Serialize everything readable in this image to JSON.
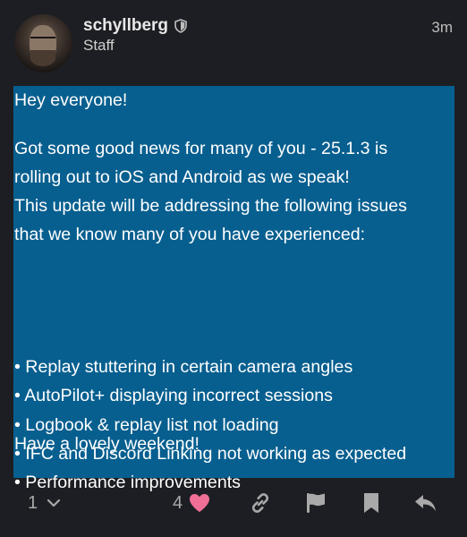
{
  "post": {
    "username": "schyllberg",
    "user_title": "Staff",
    "time_ago": "3m",
    "greeting": "Hey everyone!",
    "paragraph_lines": [
      "Got some good news for many of you - 25.1.3 is",
      "rolling out to iOS and Android as we speak!",
      "This update will be addressing the following issues",
      "that we know many of you have experienced:"
    ],
    "list_items": [
      "• Replay stuttering in certain camera angles",
      "• AutoPilot+ displaying incorrect sessions",
      "• Logbook & replay list not loading",
      "• IFC and Discord Linking not working as expected",
      "• Performance improvements"
    ],
    "closing": "Have a lovely weekend!"
  },
  "actions": {
    "reply_count": "1",
    "like_count": "4",
    "icons": [
      "chevron-down-icon",
      "heart-icon",
      "link-icon",
      "flag-icon",
      "bookmark-icon",
      "reply-icon"
    ]
  },
  "colors": {
    "background": "#1d1e23",
    "body_highlight": "#075f8f",
    "heart": "#f06f96",
    "muted": "#a9a9a9"
  }
}
